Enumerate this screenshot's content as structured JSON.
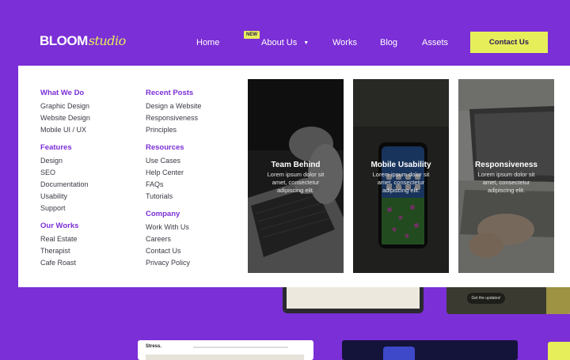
{
  "header": {
    "logo_main": "BLOOM",
    "logo_script": "studio",
    "nav": [
      {
        "label": "Home"
      },
      {
        "label": "About Us"
      },
      {
        "label": "Works"
      },
      {
        "label": "Blog"
      },
      {
        "label": "Assets"
      }
    ],
    "new_badge": "NEW",
    "cta_label": "Contact Us"
  },
  "menu": {
    "col1": [
      {
        "title": "What We Do",
        "links": [
          "Graphic Design",
          "Website Design",
          "Mobile UI / UX"
        ]
      },
      {
        "title": "Features",
        "links": [
          "Design",
          "SEO",
          "Documentation",
          "Usability",
          "Support"
        ]
      },
      {
        "title": "Our Works",
        "links": [
          "Real Estate",
          "Therapist",
          "Cafe Roast"
        ]
      }
    ],
    "col2": [
      {
        "title": "Recent Posts",
        "links": [
          "Design a Website",
          "Responsiveness",
          "Principles"
        ]
      },
      {
        "title": "Resources",
        "links": [
          "Use Cases",
          "Help Center",
          "FAQs",
          "Tutorials"
        ]
      },
      {
        "title": "Company",
        "links": [
          "Work With Us",
          "Careers",
          "Contact Us",
          "Privacy Policy"
        ]
      }
    ],
    "cards": [
      {
        "title": "Team Behind",
        "desc": "Lorem ipsum dolor sit amet, consectetur adipiscing elit."
      },
      {
        "title": "Mobile Usability",
        "desc": "Lorem ipsum dolor sit amet, consectetur adipiscing elit."
      },
      {
        "title": "Responsiveness",
        "desc": "Lorem ipsum dolor sit amet, consectetur adipiscing elit."
      }
    ]
  },
  "previews": {
    "bottom_left_brand": "Stress.",
    "button_text": "Get the updates!"
  },
  "colors": {
    "background": "#7b2fd6",
    "accent": "#e6ef5a",
    "menu_heading": "#7b2fd6"
  }
}
